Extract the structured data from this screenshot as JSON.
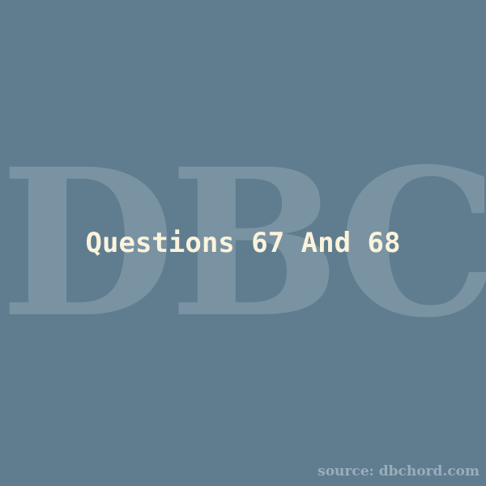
{
  "watermark": {
    "text": "DBC"
  },
  "title": "Questions 67 And 68",
  "source": "source: dbchord.com",
  "colors": {
    "background": "#5f7d8f",
    "watermark": "#7a93a3",
    "title": "#fbf3dc",
    "source": "#9aaebb"
  }
}
